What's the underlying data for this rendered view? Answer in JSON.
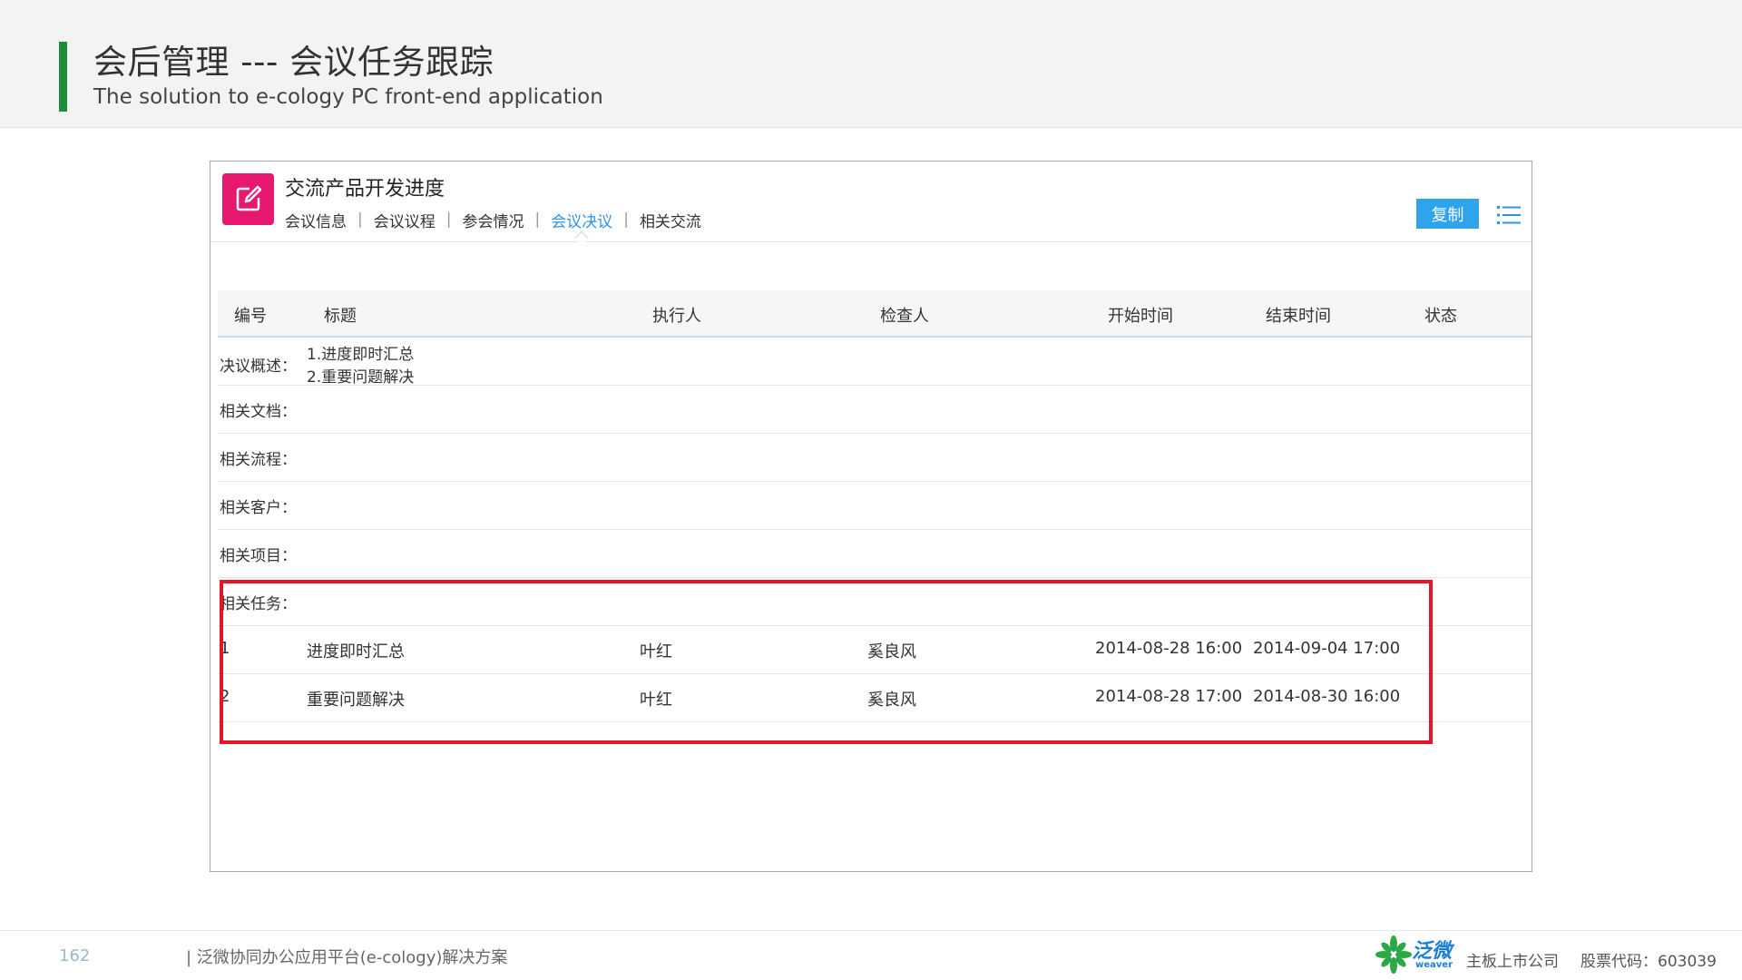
{
  "slide": {
    "title": "会后管理 --- 会议任务跟踪",
    "subtitle": "The solution to e-cology PC front-end application"
  },
  "app": {
    "title": "交流产品开发进度",
    "icon": "edit-icon",
    "tabs": [
      {
        "label": "会议信息"
      },
      {
        "label": "会议议程"
      },
      {
        "label": "参会情况"
      },
      {
        "label": "会议决议",
        "active": true
      },
      {
        "label": "相关交流"
      }
    ],
    "separator": "|",
    "copy_label": "复制",
    "menu_icon": "list-menu-icon",
    "accent_color": "#2fa3ec",
    "icon_color": "#e8176f"
  },
  "table": {
    "columns": [
      "编号",
      "标题",
      "执行人",
      "检查人",
      "开始时间",
      "结束时间",
      "状态"
    ],
    "summary_label": "决议概述：",
    "summary_lines": [
      "1.进度即时汇总",
      "2.重要问题解决"
    ],
    "related_labels": {
      "docs": "相关文档：",
      "workflow": "相关流程：",
      "customer": "相关客户：",
      "project": "相关项目：",
      "tasks": "相关任务："
    },
    "tasks": [
      {
        "no": "1",
        "title": "进度即时汇总",
        "executor": "叶红",
        "checker": "奚良风",
        "start": "2014-08-28 16:00",
        "end": "2014-09-04 17:00"
      },
      {
        "no": "2",
        "title": "重要问题解决",
        "executor": "叶红",
        "checker": "奚良风",
        "start": "2014-08-28 17:00",
        "end": "2014-08-30 16:00"
      }
    ],
    "highlight_color": "#e4152b"
  },
  "footer": {
    "page_number": "162",
    "text": "| 泛微协同办公应用平台(e-cology)解决方案",
    "logo_cn": "泛微",
    "logo_en": "weaver",
    "company": "主板上市公司",
    "stock": "股票代码：603039"
  }
}
